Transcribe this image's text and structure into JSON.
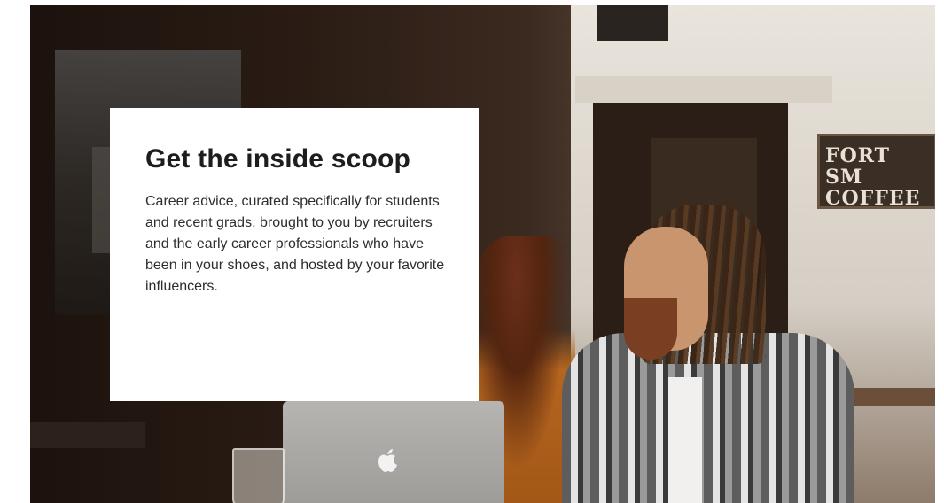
{
  "hero": {
    "title": "Get the inside scoop",
    "body": "Career advice, curated specifically for students and recent grads, brought to you by recruiters and the early career professionals who have been in your shoes, and hosted by your favorite influencers.",
    "background_sign_text": "FORT SM COFFEE"
  },
  "icons": {
    "laptop_logo": "apple-logo-icon"
  },
  "colors": {
    "card_background": "#ffffff",
    "title_color": "#1d1d1d",
    "body_color": "#2d2d2d"
  }
}
